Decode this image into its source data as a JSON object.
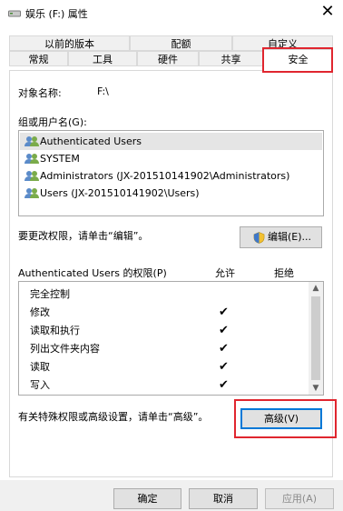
{
  "window": {
    "title": "娱乐 (F:) 属性",
    "close_glyph": "✕"
  },
  "tabs": {
    "row1": [
      "以前的版本",
      "配额",
      "自定义"
    ],
    "row2": [
      "常规",
      "工具",
      "硬件",
      "共享",
      "安全"
    ],
    "active": "安全"
  },
  "object": {
    "label": "对象名称:",
    "value": "F:\\"
  },
  "groups": {
    "label": "组或用户名(G):",
    "items": [
      "Authenticated Users",
      "SYSTEM",
      "Administrators (JX-201510141902\\Administrators)",
      "Users (JX-201510141902\\Users)"
    ],
    "selected_index": 0
  },
  "change_perm": {
    "text": "要更改权限，请单击“编辑”。",
    "edit_button": "编辑(E)..."
  },
  "permissions": {
    "title": "Authenticated Users 的权限(P)",
    "allow_header": "允许",
    "deny_header": "拒绝",
    "rows": [
      {
        "name": "完全控制",
        "allow": ""
      },
      {
        "name": "修改",
        "allow": "✔"
      },
      {
        "name": "读取和执行",
        "allow": "✔"
      },
      {
        "name": "列出文件夹内容",
        "allow": "✔"
      },
      {
        "name": "读取",
        "allow": "✔"
      },
      {
        "name": "写入",
        "allow": "✔"
      }
    ]
  },
  "advanced": {
    "text": "有关特殊权限或高级设置，请单击“高级”。",
    "button": "高级(V)"
  },
  "footer": {
    "ok": "确定",
    "cancel": "取消",
    "apply": "应用(A)"
  },
  "colors": {
    "highlight_red": "#e0262f",
    "focus_blue": "#0078d7",
    "selected_row": "#e5e5e5"
  }
}
